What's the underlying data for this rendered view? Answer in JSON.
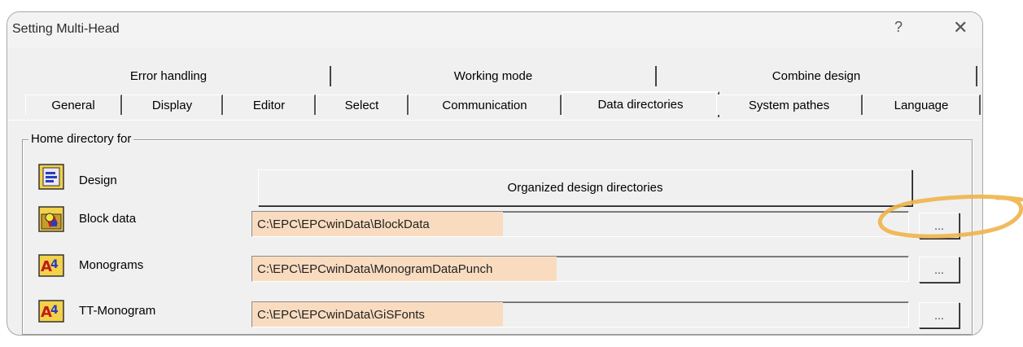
{
  "window": {
    "title": "Setting Multi-Head",
    "help_label": "?",
    "close_label": "✕"
  },
  "tabs": {
    "row1": [
      "Error handling",
      "Working mode",
      "Combine design"
    ],
    "row2": [
      "General",
      "Display",
      "Editor",
      "Select",
      "Communication",
      "Data directories",
      "System pathes",
      "Language"
    ],
    "active": "Data directories"
  },
  "group": {
    "legend": "Home directory for"
  },
  "design": {
    "label": "Design",
    "icon": "design-folder-icon",
    "button_label": "Organized design directories"
  },
  "rows": [
    {
      "label": "Block data",
      "icon": "block-data-folder-icon",
      "path": "C:\\EPC\\EPCwinData\\BlockData",
      "browse_label": "..."
    },
    {
      "label": "Monograms",
      "icon": "monogram-folder-icon",
      "path": "C:\\EPC\\EPCwinData\\MonogramDataPunch",
      "browse_label": "..."
    },
    {
      "label": "TT-Monogram",
      "icon": "tt-monogram-folder-icon",
      "path": "C:\\EPC\\EPCwinData\\GiSFonts",
      "browse_label": "..."
    }
  ],
  "colors": {
    "highlight": "#f9dcc0",
    "annotation": "#f0b24a"
  }
}
